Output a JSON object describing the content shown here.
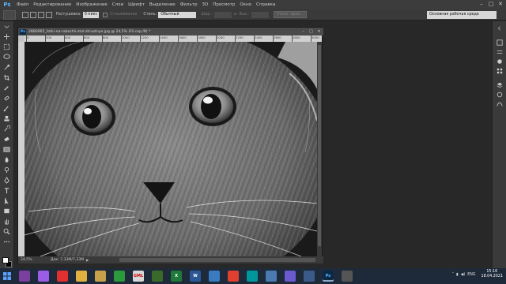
{
  "app": {
    "logo": "Ps",
    "menu": [
      "Файл",
      "Редактирование",
      "Изображение",
      "Слои",
      "Шрифт",
      "Выделение",
      "Фильтр",
      "3D",
      "Просмотр",
      "Окно",
      "Справка"
    ],
    "window_controls": [
      "–",
      "□",
      "✕"
    ]
  },
  "options": {
    "feather_label": "Растушевка:",
    "feather_value": "0 пикс",
    "antialias_label": "Сглаживание",
    "style_label": "Стиль:",
    "style_value": "Обычный",
    "width_label": "Шир.:",
    "height_label": "Выс.:",
    "refine_button": "Уточн. край...",
    "workspace": "Основная рабочая среда"
  },
  "document": {
    "title": "2880965_fotki-na-rabochii-stol-zhivotnye.jpg @ 24,5% (Fil.сер./8) *",
    "ruler_numbers": [
      "0",
      "200",
      "400",
      "600",
      "800",
      "1000",
      "1200",
      "1400",
      "1600",
      "1800",
      "2000",
      "2200",
      "2400",
      "2600",
      "2800",
      "3000"
    ],
    "zoom": "24,5%",
    "doc_size": "Док: 7,33M/7,33M",
    "zoom_percent": 24.5
  },
  "taskbar": {
    "apps": [
      {
        "name": "browser-icon",
        "color": "#7b3fa0",
        "label": ""
      },
      {
        "name": "alice-icon",
        "color": "#9b5de5",
        "label": ""
      },
      {
        "name": "media-icon",
        "color": "#e03030",
        "label": ""
      },
      {
        "name": "folder-icon",
        "color": "#e0b040",
        "label": ""
      },
      {
        "name": "image-viewer-icon",
        "color": "#c9a04a",
        "label": ""
      },
      {
        "name": "game-icon",
        "color": "#2a9a3a",
        "label": ""
      },
      {
        "name": "gml-icon",
        "color": "#d8d8d8",
        "label": "GML"
      },
      {
        "name": "video-icon",
        "color": "#3a6a2a",
        "label": ""
      },
      {
        "name": "excel-icon",
        "color": "#1f7a3a",
        "label": "X"
      },
      {
        "name": "word-icon",
        "color": "#2b5797",
        "label": "W"
      },
      {
        "name": "photo-icon",
        "color": "#3a7ac0",
        "label": ""
      },
      {
        "name": "yandex-icon",
        "color": "#e04030",
        "label": ""
      },
      {
        "name": "arduino-icon",
        "color": "#00979c",
        "label": ""
      },
      {
        "name": "cloud-icon",
        "color": "#4a7ab0",
        "label": ""
      },
      {
        "name": "players-icon",
        "color": "#6a5acd",
        "label": ""
      },
      {
        "name": "onenote-icon",
        "color": "#3a5a8a",
        "label": ""
      },
      {
        "name": "photoshop-icon",
        "color": "#0b2845",
        "label": "Ps"
      },
      {
        "name": "files-icon",
        "color": "#555",
        "label": ""
      }
    ],
    "lang": "ENG",
    "time": "15:16",
    "date": "18.04.2021"
  },
  "colors": {
    "accent": "#5fb4ff",
    "foreground_swatch": "#ffffff",
    "background_swatch": "#000000"
  }
}
